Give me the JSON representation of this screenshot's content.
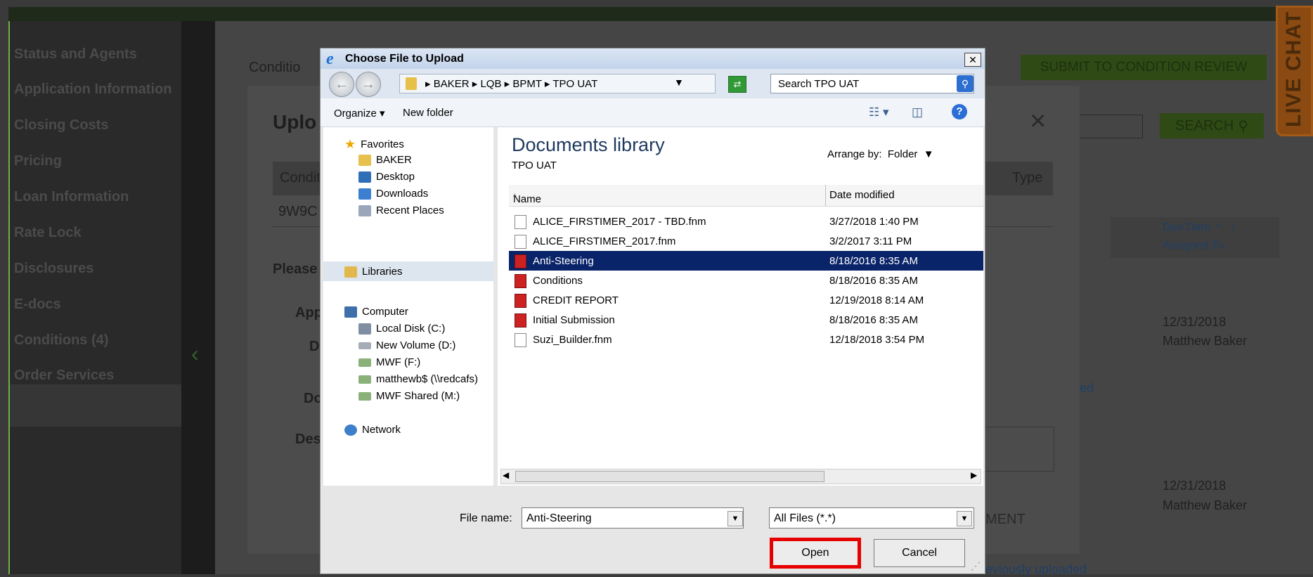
{
  "background": {
    "sidebar": [
      {
        "label": "Status and Agents"
      },
      {
        "label": "Application Information"
      },
      {
        "label": "Closing Costs"
      },
      {
        "label": "Pricing"
      },
      {
        "label": "Loan Information"
      },
      {
        "label": "Rate Lock"
      },
      {
        "label": "Disclosures"
      },
      {
        "label": "E-docs"
      },
      {
        "label": "Conditions (4)"
      },
      {
        "label": "Order Services"
      }
    ],
    "page_title_partial": "Conditio",
    "submit_button": "SUBMIT TO CONDITION REVIEW",
    "search_button": "SEARCH",
    "due_date_header": "Due Date",
    "due_sep": "/",
    "assigned_to_header": "Assigned To",
    "rows": [
      {
        "due": "12/31/2018",
        "assigned": "Matthew Baker"
      },
      {
        "due": "12/31/2018",
        "assigned": "Matthew Baker"
      }
    ],
    "link_partial_1": "ed",
    "link_partial_2": "eviously uploaded",
    "live_chat": "LIVE CHAT",
    "modal": {
      "title_partial": "Uplo",
      "close": "×",
      "col_condition_partial": "Condit",
      "col_type_partial": "Type",
      "row_id_partial": "9W9C",
      "please_partial": "Please",
      "app_partial": "App",
      "d_partial": "D",
      "doc_partial": "Do",
      "desc_partial": "Des",
      "doc_button_partial": "MENT"
    }
  },
  "dialog": {
    "title": "Choose File to Upload",
    "close": "✕",
    "breadcrumb": [
      "BAKER",
      "LQB",
      "BPMT",
      "TPO UAT"
    ],
    "search_placeholder": "Search TPO UAT",
    "toolbar": {
      "organize": "Organize",
      "new_folder": "New folder"
    },
    "nav": {
      "favorites": "Favorites",
      "fav_items": [
        "BAKER",
        "Desktop",
        "Downloads",
        "Recent Places"
      ],
      "libraries": "Libraries",
      "computer": "Computer",
      "drives": [
        "Local Disk (C:)",
        "New Volume (D:)",
        "MWF (F:)",
        "matthewb$ (\\\\redcafs)",
        "MWF Shared (M:)"
      ],
      "network": "Network"
    },
    "library_title": "Documents library",
    "library_subtitle": "TPO UAT",
    "arrange_by_label": "Arrange by:",
    "arrange_by_value": "Folder",
    "columns": {
      "name": "Name",
      "date": "Date modified"
    },
    "files": [
      {
        "name": "ALICE_FIRSTIMER_2017 - TBD.fnm",
        "date": "3/27/2018 1:40 PM",
        "type": "doc"
      },
      {
        "name": "ALICE_FIRSTIMER_2017.fnm",
        "date": "3/2/2017 3:11 PM",
        "type": "doc"
      },
      {
        "name": "Anti-Steering",
        "date": "8/18/2016 8:35 AM",
        "type": "pdf",
        "selected": true
      },
      {
        "name": "Conditions",
        "date": "8/18/2016 8:35 AM",
        "type": "pdf"
      },
      {
        "name": "CREDIT REPORT",
        "date": "12/19/2018 8:14 AM",
        "type": "pdf"
      },
      {
        "name": "Initial Submission",
        "date": "8/18/2016 8:35 AM",
        "type": "pdf"
      },
      {
        "name": "Suzi_Builder.fnm",
        "date": "12/18/2018 3:54 PM",
        "type": "doc"
      }
    ],
    "file_name_label": "File name:",
    "file_name_value": "Anti-Steering",
    "file_type_value": "All Files (*.*)",
    "open_button": "Open",
    "cancel_button": "Cancel"
  }
}
